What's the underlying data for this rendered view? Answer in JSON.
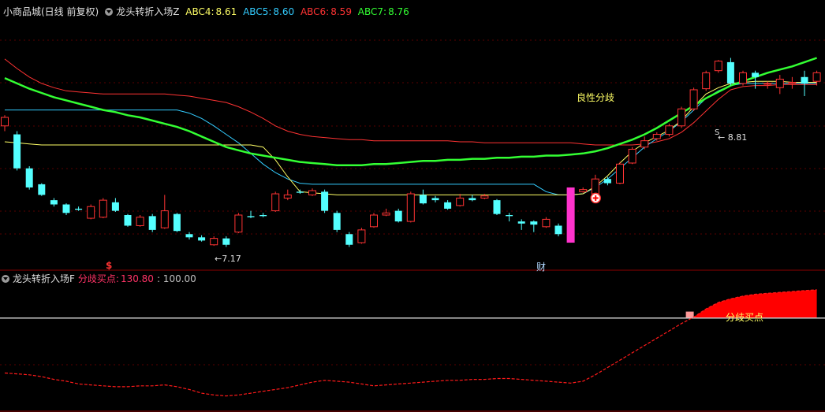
{
  "header": {
    "stock_label": "小商品城(日线 前复权)",
    "indicator_name": "龙头转折入场Z",
    "ma": [
      {
        "label": "ABC4:",
        "value": "8.61",
        "color": "#ffff66"
      },
      {
        "label": "ABC5:",
        "value": "8.60",
        "color": "#33ccff"
      },
      {
        "label": "ABC6:",
        "value": "8.59",
        "color": "#ff3333"
      },
      {
        "label": "ABC7:",
        "value": "8.76",
        "color": "#33ff33"
      }
    ]
  },
  "sub_header": {
    "indicator_name": "龙头转折入场F",
    "label": "分歧买点:",
    "value": "130.80",
    "level_text": ": 100.00"
  },
  "annotations": {
    "benign_divergence": "良性分歧",
    "low_label": "←7.17",
    "high_label": "← 8.81",
    "dollar_mark": "$",
    "cai_mark": "财",
    "buy_point_label": "分歧买点",
    "s_mark": "S"
  },
  "colors": {
    "up": "#ff3333",
    "down": "#54ffff",
    "ma4": "#ffff66",
    "ma5": "#33ccff",
    "ma6": "#ff3333",
    "ma7": "#33ff33",
    "magenta": "#ff33cc",
    "fill": "#ff0000"
  },
  "chart_data": [
    {
      "type": "candlestick",
      "title": "小商品城(日线 前复权)",
      "ylim": [
        6.9,
        9.2
      ],
      "candles": [
        [
          8.2,
          8.28,
          8.3,
          8.15
        ],
        [
          8.12,
          7.8,
          8.15,
          7.78
        ],
        [
          7.8,
          7.62,
          7.82,
          7.6
        ],
        [
          7.65,
          7.55,
          7.66,
          7.54
        ],
        [
          7.5,
          7.46,
          7.52,
          7.44
        ],
        [
          7.46,
          7.38,
          7.47,
          7.36
        ],
        [
          7.42,
          7.41,
          7.44,
          7.4
        ],
        [
          7.33,
          7.44,
          7.46,
          7.32
        ],
        [
          7.34,
          7.5,
          7.52,
          7.33
        ],
        [
          7.48,
          7.4,
          7.52,
          7.39
        ],
        [
          7.36,
          7.26,
          7.37,
          7.25
        ],
        [
          7.26,
          7.34,
          7.36,
          7.25
        ],
        [
          7.35,
          7.22,
          7.37,
          7.2
        ],
        [
          7.24,
          7.4,
          7.55,
          7.23
        ],
        [
          7.37,
          7.21,
          7.38,
          7.2
        ],
        [
          7.18,
          7.15,
          7.2,
          7.13
        ],
        [
          7.15,
          7.12,
          7.17,
          7.11
        ],
        [
          7.08,
          7.14,
          7.16,
          7.07
        ],
        [
          7.14,
          7.08,
          7.16,
          7.06
        ],
        [
          7.2,
          7.36,
          7.38,
          7.19
        ],
        [
          7.35,
          7.34,
          7.4,
          7.33
        ],
        [
          7.36,
          7.35,
          7.38,
          7.34
        ],
        [
          7.4,
          7.56,
          7.58,
          7.39
        ],
        [
          7.52,
          7.55,
          7.6,
          7.5
        ],
        [
          7.58,
          7.57,
          7.6,
          7.56
        ],
        [
          7.55,
          7.59,
          7.61,
          7.54
        ],
        [
          7.58,
          7.4,
          7.6,
          7.38
        ],
        [
          7.38,
          7.22,
          7.4,
          7.2
        ],
        [
          7.18,
          7.08,
          7.2,
          7.06
        ],
        [
          7.1,
          7.22,
          7.24,
          7.09
        ],
        [
          7.25,
          7.36,
          7.38,
          7.24
        ],
        [
          7.36,
          7.38,
          7.42,
          7.35
        ],
        [
          7.4,
          7.3,
          7.42,
          7.29
        ],
        [
          7.3,
          7.56,
          7.58,
          7.29
        ],
        [
          7.55,
          7.47,
          7.6,
          7.46
        ],
        [
          7.52,
          7.5,
          7.54,
          7.48
        ],
        [
          7.48,
          7.42,
          7.5,
          7.41
        ],
        [
          7.45,
          7.52,
          7.56,
          7.44
        ],
        [
          7.52,
          7.5,
          7.55,
          7.49
        ],
        [
          7.52,
          7.54,
          7.56,
          7.51
        ],
        [
          7.5,
          7.37,
          7.51,
          7.36
        ],
        [
          7.36,
          7.35,
          7.38,
          7.3
        ],
        [
          7.3,
          7.28,
          7.32,
          7.22
        ],
        [
          7.3,
          7.27,
          7.31,
          7.2
        ],
        [
          7.25,
          7.32,
          7.34,
          7.24
        ],
        [
          7.26,
          7.18,
          7.28,
          7.16
        ],
        [
          7.6,
          7.12,
          7.62,
          7.1
        ],
        [
          7.58,
          7.6,
          7.62,
          7.57
        ],
        [
          7.56,
          7.7,
          7.74,
          7.55
        ],
        [
          7.7,
          7.66,
          7.72,
          7.64
        ],
        [
          7.66,
          7.84,
          7.86,
          7.65
        ],
        [
          7.85,
          7.98,
          8.0,
          7.84
        ],
        [
          8.0,
          8.06,
          8.1,
          7.98
        ],
        [
          8.08,
          8.12,
          8.14,
          8.06
        ],
        [
          8.12,
          8.2,
          8.22,
          8.1
        ],
        [
          8.2,
          8.36,
          8.38,
          8.18
        ],
        [
          8.36,
          8.54,
          8.56,
          8.34
        ],
        [
          8.55,
          8.7,
          8.72,
          8.53
        ],
        [
          8.72,
          8.81,
          8.82,
          8.7
        ],
        [
          8.8,
          8.6,
          8.84,
          8.58
        ],
        [
          8.6,
          8.7,
          8.72,
          8.58
        ],
        [
          8.7,
          8.66,
          8.72,
          8.55
        ],
        [
          8.6,
          8.6,
          8.62,
          8.55
        ],
        [
          8.56,
          8.64,
          8.68,
          8.5
        ],
        [
          8.6,
          8.61,
          8.66,
          8.55
        ],
        [
          8.66,
          8.6,
          8.72,
          8.48
        ],
        [
          8.62,
          8.7,
          8.72,
          8.58
        ]
      ],
      "ma4": [
        8.05,
        8.04,
        8.03,
        8.02,
        8.02,
        8.02,
        8.02,
        8.02,
        8.02,
        8.02,
        8.02,
        8.02,
        8.02,
        8.02,
        8.02,
        8.02,
        8.02,
        8.02,
        8.02,
        8.02,
        8.02,
        8.0,
        7.88,
        7.72,
        7.58,
        7.57,
        7.56,
        7.55,
        7.55,
        7.55,
        7.55,
        7.55,
        7.55,
        7.55,
        7.55,
        7.55,
        7.55,
        7.55,
        7.55,
        7.55,
        7.55,
        7.55,
        7.55,
        7.55,
        7.55,
        7.55,
        7.55,
        7.56,
        7.63,
        7.73,
        7.85,
        7.96,
        8.04,
        8.1,
        8.16,
        8.25,
        8.38,
        8.5,
        8.56,
        8.6,
        8.61,
        8.62,
        8.62,
        8.62,
        8.61,
        8.61,
        8.61
      ],
      "ma5": [
        8.35,
        8.35,
        8.35,
        8.35,
        8.35,
        8.35,
        8.35,
        8.35,
        8.35,
        8.35,
        8.35,
        8.35,
        8.35,
        8.35,
        8.35,
        8.32,
        8.27,
        8.2,
        8.12,
        8.04,
        7.94,
        7.84,
        7.76,
        7.7,
        7.66,
        7.65,
        7.65,
        7.65,
        7.65,
        7.65,
        7.65,
        7.65,
        7.65,
        7.65,
        7.65,
        7.65,
        7.65,
        7.65,
        7.65,
        7.65,
        7.65,
        7.65,
        7.65,
        7.65,
        7.58,
        7.55,
        7.55,
        7.56,
        7.62,
        7.7,
        7.8,
        7.9,
        8.0,
        8.08,
        8.15,
        8.24,
        8.35,
        8.46,
        8.53,
        8.58,
        8.6,
        8.6,
        8.6,
        8.6,
        8.6,
        8.6,
        8.6
      ],
      "ma6": [
        8.83,
        8.74,
        8.66,
        8.6,
        8.56,
        8.53,
        8.52,
        8.51,
        8.5,
        8.5,
        8.5,
        8.5,
        8.5,
        8.5,
        8.49,
        8.48,
        8.46,
        8.44,
        8.42,
        8.38,
        8.33,
        8.27,
        8.2,
        8.15,
        8.12,
        8.1,
        8.09,
        8.08,
        8.07,
        8.07,
        8.06,
        8.06,
        8.06,
        8.06,
        8.06,
        8.06,
        8.06,
        8.05,
        8.05,
        8.04,
        8.04,
        8.04,
        8.04,
        8.04,
        8.04,
        8.04,
        8.04,
        8.03,
        8.02,
        8.02,
        8.02,
        8.02,
        8.03,
        8.05,
        8.08,
        8.14,
        8.23,
        8.34,
        8.45,
        8.54,
        8.57,
        8.58,
        8.58,
        8.59,
        8.59,
        8.59,
        8.59
      ],
      "ma7": [
        8.65,
        8.6,
        8.55,
        8.51,
        8.47,
        8.44,
        8.41,
        8.38,
        8.35,
        8.33,
        8.3,
        8.28,
        8.25,
        8.22,
        8.19,
        8.15,
        8.1,
        8.05,
        8.0,
        7.97,
        7.94,
        7.92,
        7.9,
        7.88,
        7.86,
        7.85,
        7.84,
        7.83,
        7.83,
        7.83,
        7.84,
        7.84,
        7.85,
        7.86,
        7.87,
        7.87,
        7.88,
        7.88,
        7.89,
        7.89,
        7.9,
        7.9,
        7.91,
        7.91,
        7.92,
        7.92,
        7.93,
        7.94,
        7.96,
        7.99,
        8.03,
        8.07,
        8.12,
        8.18,
        8.25,
        8.32,
        8.39,
        8.46,
        8.52,
        8.58,
        8.62,
        8.66,
        8.7,
        8.73,
        8.76,
        8.8,
        8.84
      ]
    },
    {
      "type": "line",
      "title": "龙头转折入场F",
      "ylim": [
        0,
        135
      ],
      "level": 100,
      "series": [
        {
          "name": "分歧买点",
          "values": [
            40,
            39,
            38,
            36,
            33,
            31,
            28,
            27,
            26,
            25,
            25,
            26,
            26,
            27,
            25,
            22,
            18,
            16,
            15,
            16,
            18,
            20,
            22,
            24,
            27,
            30,
            32,
            31,
            30,
            28,
            26,
            27,
            28,
            29,
            30,
            31,
            32,
            32,
            33,
            33,
            34,
            34,
            33,
            32,
            31,
            30,
            29,
            31,
            38,
            46,
            54,
            62,
            70,
            78,
            86,
            94,
            101,
            110,
            117,
            121,
            124,
            126,
            127,
            128,
            129,
            130,
            130.8
          ]
        }
      ]
    }
  ]
}
